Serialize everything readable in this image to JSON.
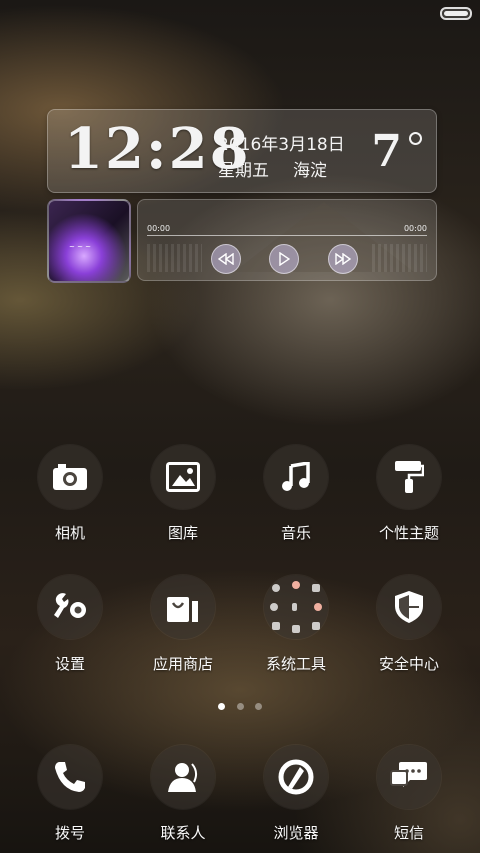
{
  "clock": {
    "time": "12:28",
    "date": "2016年3月18日",
    "weekday": "星期五",
    "location": "海淀",
    "temperature": "7"
  },
  "music": {
    "current_time": "00:00",
    "total_time": "00:00",
    "progress": 0,
    "controls": [
      "rewind-icon",
      "play-icon",
      "fast-forward-icon"
    ]
  },
  "apps": {
    "row1": [
      {
        "label": "相机",
        "icon": "camera-icon"
      },
      {
        "label": "图库",
        "icon": "gallery-icon"
      },
      {
        "label": "音乐",
        "icon": "music-note-icon"
      },
      {
        "label": "个性主题",
        "icon": "paint-roller-icon"
      }
    ],
    "row2": [
      {
        "label": "设置",
        "icon": "wrench-gear-icon"
      },
      {
        "label": "应用商店",
        "icon": "shopping-bag-icon"
      },
      {
        "label": "系统工具",
        "icon": "folder-icon"
      },
      {
        "label": "安全中心",
        "icon": "shield-icon"
      }
    ]
  },
  "pager": {
    "pages": 3,
    "active": 1
  },
  "dock": [
    {
      "label": "拨号",
      "icon": "phone-icon"
    },
    {
      "label": "联系人",
      "icon": "contacts-icon"
    },
    {
      "label": "浏览器",
      "icon": "browser-icon"
    },
    {
      "label": "短信",
      "icon": "message-icon"
    }
  ]
}
